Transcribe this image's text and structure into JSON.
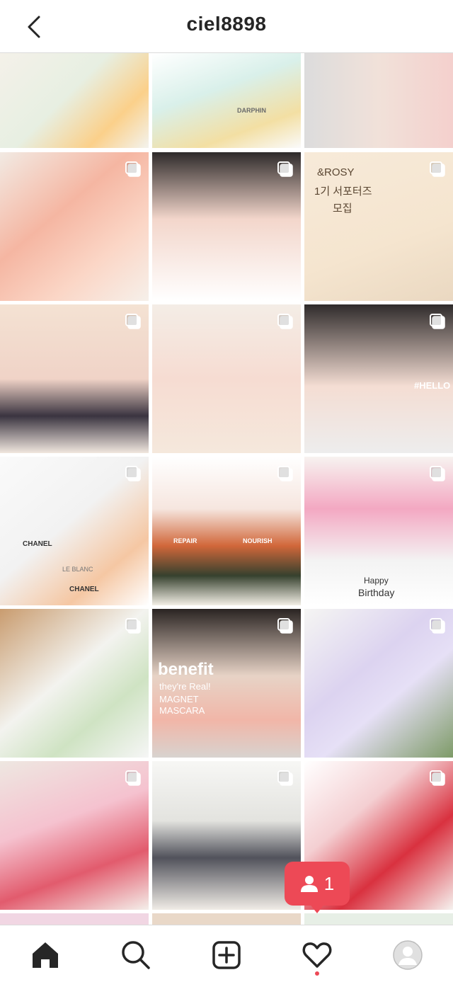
{
  "header": {
    "username": "ciel8898"
  },
  "posts": [
    {
      "row": 0,
      "col": 0,
      "multi": false,
      "desc": "green bottle cosmetics"
    },
    {
      "row": 0,
      "col": 1,
      "multi": false,
      "desc": "skincare jars on tray",
      "texts": [
        "DARPHIN"
      ]
    },
    {
      "row": 0,
      "col": 2,
      "multi": false,
      "desc": "close-up lips"
    },
    {
      "row": 1,
      "col": 0,
      "multi": true,
      "desc": "nails with flowers"
    },
    {
      "row": 1,
      "col": 1,
      "multi": true,
      "desc": "portrait selfie"
    },
    {
      "row": 1,
      "col": 2,
      "multi": true,
      "desc": "dog on stool",
      "texts": [
        "&ROSY",
        "1기 서포터즈",
        "모집"
      ]
    },
    {
      "row": 2,
      "col": 0,
      "multi": true,
      "desc": "woman in tweed dress"
    },
    {
      "row": 2,
      "col": 1,
      "multi": true,
      "desc": "pink makeup display"
    },
    {
      "row": 2,
      "col": 2,
      "multi": true,
      "desc": "woman holding foundation",
      "texts": [
        "#HELLO"
      ]
    },
    {
      "row": 3,
      "col": 0,
      "multi": true,
      "desc": "chanel products",
      "texts": [
        "CHANEL",
        "LE BLANC",
        "CHANEL"
      ]
    },
    {
      "row": 3,
      "col": 1,
      "multi": true,
      "desc": "shampoo bottles",
      "texts": [
        "REPAIR",
        "NOURISH"
      ]
    },
    {
      "row": 3,
      "col": 2,
      "multi": true,
      "desc": "dog with balloons",
      "texts": [
        "Happy",
        "Birthday"
      ]
    },
    {
      "row": 4,
      "col": 0,
      "multi": true,
      "desc": "box of products"
    },
    {
      "row": 4,
      "col": 1,
      "multi": true,
      "desc": "mascara ad",
      "texts": [
        "benefit",
        "they're Real!",
        "MAGNET",
        "MASCARA"
      ]
    },
    {
      "row": 4,
      "col": 2,
      "multi": true,
      "desc": "hand holding tubes"
    },
    {
      "row": 5,
      "col": 0,
      "multi": true,
      "desc": "woman with desserts"
    },
    {
      "row": 5,
      "col": 1,
      "multi": true,
      "desc": "dog with bag"
    },
    {
      "row": 5,
      "col": 2,
      "multi": true,
      "desc": "red skincare set"
    }
  ],
  "notification": {
    "count": "1"
  },
  "bottom_nav": [
    "home-icon",
    "search-icon",
    "new-post-icon",
    "activity-heart-icon",
    "profile-avatar"
  ]
}
